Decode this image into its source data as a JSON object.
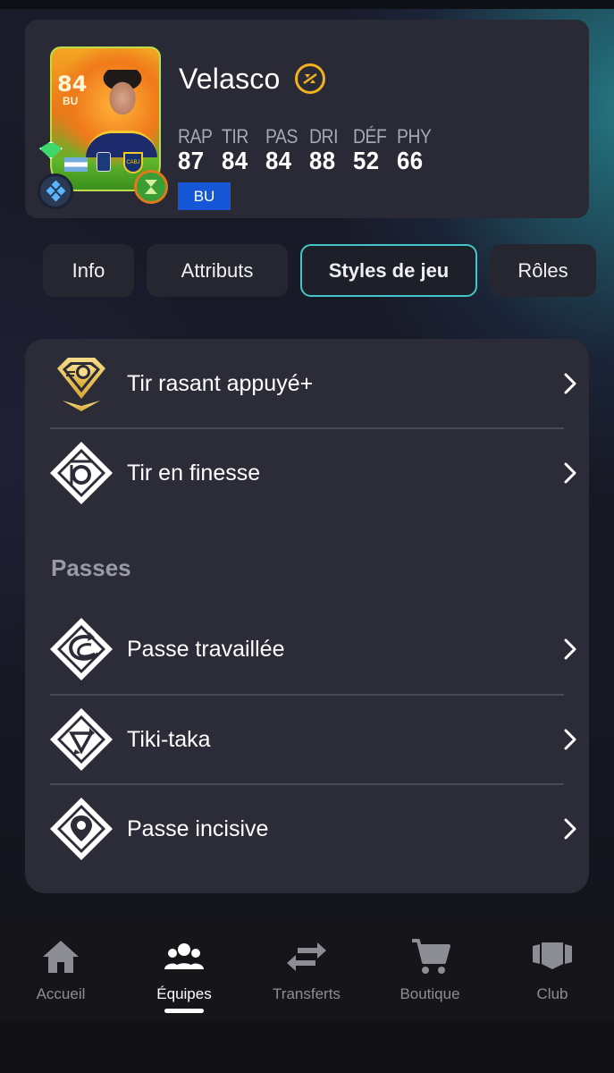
{
  "player": {
    "rating": "84",
    "card_position": "BU",
    "name": "Velasco",
    "stats": [
      {
        "label": "RAP",
        "value": "87"
      },
      {
        "label": "TIR",
        "value": "84"
      },
      {
        "label": "PAS",
        "value": "84"
      },
      {
        "label": "DRI",
        "value": "88"
      },
      {
        "label": "DÉF",
        "value": "52"
      },
      {
        "label": "PHY",
        "value": "66"
      }
    ],
    "position_pill": "BU",
    "club_badge_text": "CABJ"
  },
  "tabs": [
    {
      "label": "Info"
    },
    {
      "label": "Attributs"
    },
    {
      "label": "Styles de jeu",
      "active": true
    },
    {
      "label": "Rôles"
    }
  ],
  "playstyles": {
    "items": [
      {
        "label": "Tir rasant appuyé+",
        "icon": "low-driven-shot-plus-icon",
        "plus": true
      },
      {
        "label": "Tir en finesse",
        "icon": "finesse-shot-icon"
      }
    ],
    "section_title": "Passes",
    "passing_items": [
      {
        "label": "Passe travaillée",
        "icon": "incisive-pass-curve-icon"
      },
      {
        "label": "Tiki-taka",
        "icon": "tiki-taka-icon"
      },
      {
        "label": "Passe incisive",
        "icon": "pinged-pass-icon"
      }
    ]
  },
  "nav": [
    {
      "label": "Accueil",
      "icon": "home-icon"
    },
    {
      "label": "Équipes",
      "icon": "team-icon",
      "active": true
    },
    {
      "label": "Transferts",
      "icon": "transfer-icon"
    },
    {
      "label": "Boutique",
      "icon": "cart-icon"
    },
    {
      "label": "Club",
      "icon": "club-icon"
    }
  ],
  "colors": {
    "accent": "#43c6c9",
    "position_pill": "#1557d6",
    "gold": "#f2b21e"
  }
}
